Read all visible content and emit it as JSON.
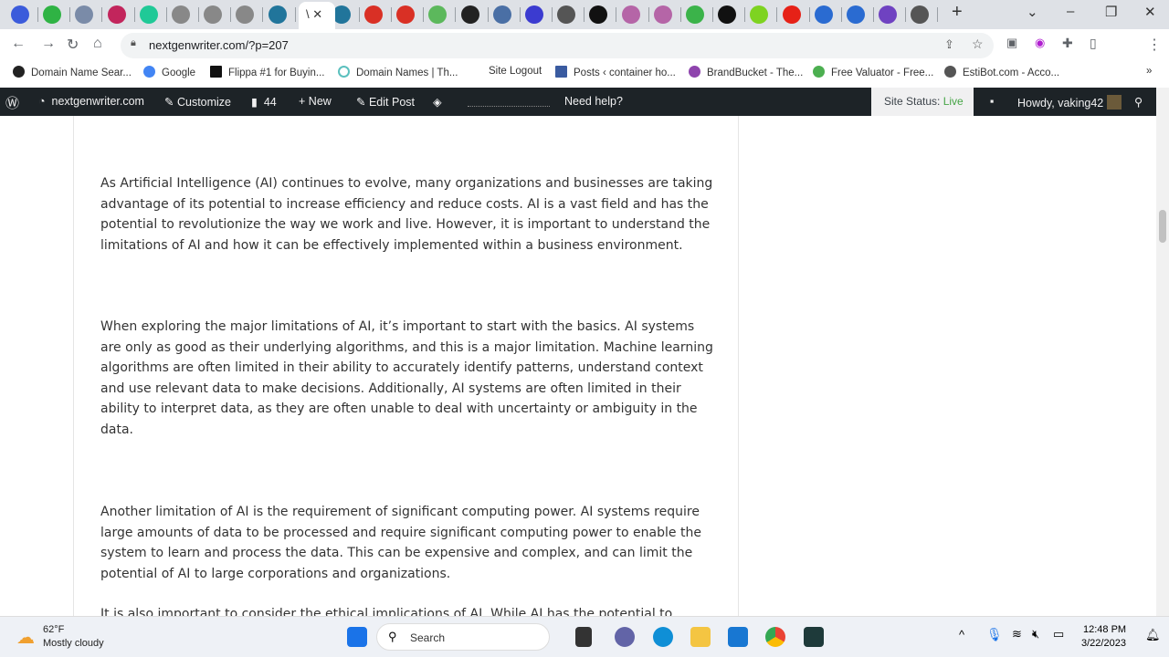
{
  "browser": {
    "url": "nextgenwriter.com/?p=207",
    "active_tab_title": "\\"
  },
  "tab_icon_colors": [
    "#3b5bdb",
    "#2fb344",
    "#7a8ba8",
    "#c2255c",
    "#20c997",
    "#888",
    "#888",
    "#888",
    "#21759b",
    "#21759b",
    "#d93025",
    "#d93025",
    "#5cb85c",
    "#222",
    "#4a6fa5",
    "#3b3bd0",
    "#555",
    "#111",
    "#b565a7",
    "#b565a7",
    "#3bb34a",
    "#111",
    "#7ed321",
    "#e62117",
    "#2a6bd1",
    "#2a6bd1",
    "#6f42c1",
    "#555"
  ],
  "bookmarks": [
    "Domain Name Sear...",
    "Google",
    "Flippa #1 for Buyin...",
    "Domain Names | Th...",
    "Site Logout",
    "Posts ‹ container ho...",
    "BrandBucket - The...",
    "Free Valuator - Free...",
    "EstiBot.com - Acco..."
  ],
  "admin_bar": {
    "site": "nextgenwriter.com",
    "customize": "Customize",
    "comments": "44",
    "new": "New",
    "edit_post": "Edit Post",
    "help": "Need help?",
    "status_label": "Site Status:",
    "status_value": "Live",
    "howdy": "Howdy, vaking42"
  },
  "content": {
    "paragraphs": [
      "As Artificial Intelligence (AI) continues to evolve, many organizations and businesses are taking advantage of its potential to increase efficiency and reduce costs. AI is a vast field and has the potential to revolutionize the way we work and live. However, it is important to understand the limitations of AI and how it can be effectively implemented within a business environment.",
      "When exploring the major limitations of AI, it’s important to start with the basics. AI systems are only as good as their underlying algorithms, and this is a major limitation. Machine learning algorithms are often limited in their ability to accurately identify patterns, understand context and use relevant data to make decisions. Additionally, AI systems are often limited in their ability to interpret data, as they are often unable to deal with uncertainty or ambiguity in the data.",
      "Another limitation of AI is the requirement of significant computing power. AI systems require large amounts of data to be processed and require significant computing power to enable the system to learn and process the data. This can be expensive and complex, and can limit the potential of AI to large corporations and organizations.",
      "It is also important to consider the ethical implications of AI. While AI has the potential to"
    ]
  },
  "taskbar": {
    "temp": "62°F",
    "weather": "Mostly cloudy",
    "search": "Search",
    "time": "12:48 PM",
    "date": "3/22/2023"
  }
}
